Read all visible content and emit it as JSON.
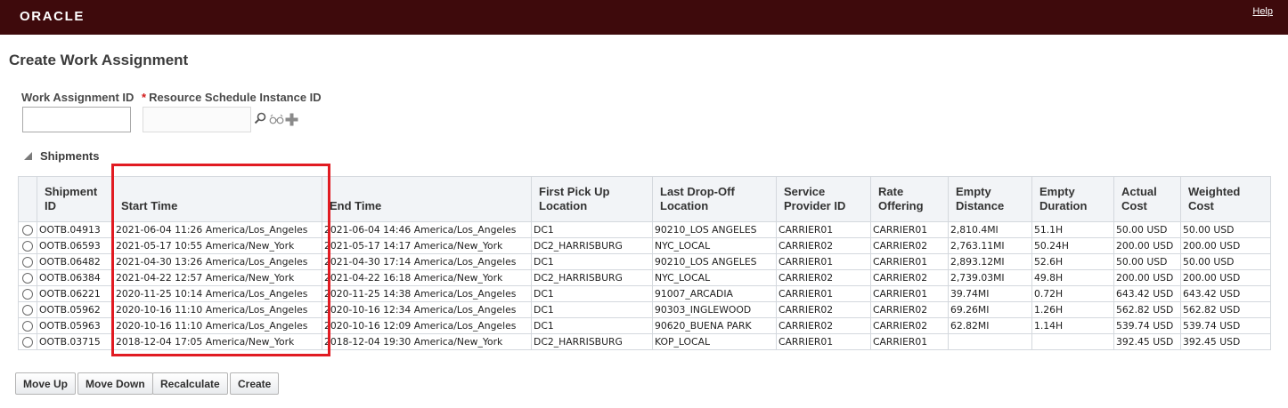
{
  "header": {
    "logo": "ORACLE",
    "help_label": "Help"
  },
  "page": {
    "title": "Create Work Assignment"
  },
  "form": {
    "work_assignment_id": {
      "label": "Work Assignment ID",
      "value": ""
    },
    "resource_schedule_instance_id": {
      "required_mark": "*",
      "label": "Resource Schedule Instance ID",
      "value": ""
    }
  },
  "icons": {
    "search": "search-icon",
    "view": "glasses-icon",
    "add": "plus-icon"
  },
  "shipments": {
    "title": "Shipments",
    "columns": [
      "Shipment ID",
      "Start Time",
      "End Time",
      "First Pick Up Location",
      "Last Drop-Off Location",
      "Service Provider ID",
      "Rate Offering",
      "Empty Distance",
      "Empty Duration",
      "Actual Cost",
      "Weighted Cost"
    ],
    "rows": [
      [
        "OOTB.04913",
        "2021-06-04 11:26 America/Los_Angeles",
        "2021-06-04 14:46 America/Los_Angeles",
        "DC1",
        "90210_LOS ANGELES",
        "CARRIER01",
        "CARRIER01",
        "2,810.4MI",
        "51.1H",
        "50.00 USD",
        "50.00 USD"
      ],
      [
        "OOTB.06593",
        "2021-05-17 10:55 America/New_York",
        "2021-05-17 14:17 America/New_York",
        "DC2_HARRISBURG",
        "NYC_LOCAL",
        "CARRIER02",
        "CARRIER02",
        "2,763.11MI",
        "50.24H",
        "200.00 USD",
        "200.00 USD"
      ],
      [
        "OOTB.06482",
        "2021-04-30 13:26 America/Los_Angeles",
        "2021-04-30 17:14 America/Los_Angeles",
        "DC1",
        "90210_LOS ANGELES",
        "CARRIER01",
        "CARRIER01",
        "2,893.12MI",
        "52.6H",
        "50.00 USD",
        "50.00 USD"
      ],
      [
        "OOTB.06384",
        "2021-04-22 12:57 America/New_York",
        "2021-04-22 16:18 America/New_York",
        "DC2_HARRISBURG",
        "NYC_LOCAL",
        "CARRIER02",
        "CARRIER02",
        "2,739.03MI",
        "49.8H",
        "200.00 USD",
        "200.00 USD"
      ],
      [
        "OOTB.06221",
        "2020-11-25 10:14 America/Los_Angeles",
        "2020-11-25 14:38 America/Los_Angeles",
        "DC1",
        "91007_ARCADIA",
        "CARRIER01",
        "CARRIER01",
        "39.74MI",
        "0.72H",
        "643.42 USD",
        "643.42 USD"
      ],
      [
        "OOTB.05962",
        "2020-10-16 11:10 America/Los_Angeles",
        "2020-10-16 12:34 America/Los_Angeles",
        "DC1",
        "90303_INGLEWOOD",
        "CARRIER02",
        "CARRIER02",
        "69.26MI",
        "1.26H",
        "562.82 USD",
        "562.82 USD"
      ],
      [
        "OOTB.05963",
        "2020-10-16 11:10 America/Los_Angeles",
        "2020-10-16 12:09 America/Los_Angeles",
        "DC1",
        "90620_BUENA PARK",
        "CARRIER02",
        "CARRIER02",
        "62.82MI",
        "1.14H",
        "539.74 USD",
        "539.74 USD"
      ],
      [
        "OOTB.03715",
        "2018-12-04 17:05 America/New_York",
        "2018-12-04 19:30 America/New_York",
        "DC2_HARRISBURG",
        "KOP_LOCAL",
        "CARRIER01",
        "CARRIER01",
        "",
        "",
        "392.45 USD",
        "392.45 USD"
      ]
    ]
  },
  "buttons": {
    "move_up": "Move Up",
    "move_down": "Move Down",
    "recalculate": "Recalculate",
    "create": "Create"
  },
  "colors": {
    "header_bg": "#3e0a0c",
    "highlight": "#e11b22"
  }
}
